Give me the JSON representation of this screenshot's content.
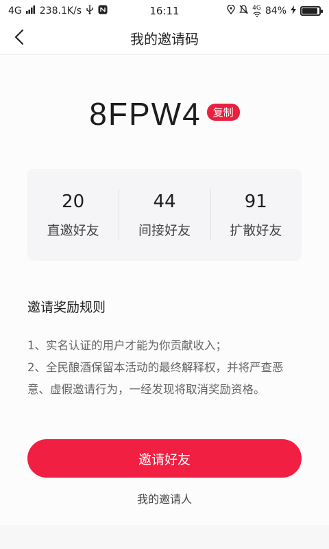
{
  "status_bar": {
    "network": "4G",
    "speed": "238.1K/s",
    "usb_icon": "usb-icon",
    "nfc_icon": "nfc-icon",
    "time": "16:11",
    "location_icon": "location-icon",
    "mute_icon": "mute-bell-icon",
    "signal_label": "4G",
    "battery_percent": "84%",
    "battery_level": 0.84,
    "charging_icon": "lightning-icon"
  },
  "nav": {
    "back_icon": "chevron-left-icon",
    "title": "我的邀请码"
  },
  "invite": {
    "code": "8FPW4",
    "copy_label": "复制"
  },
  "stats": [
    {
      "value": "20",
      "label": "直邀好友"
    },
    {
      "value": "44",
      "label": "间接好友"
    },
    {
      "value": "91",
      "label": "扩散好友"
    }
  ],
  "rules": {
    "title": "邀请奖励规则",
    "lines": [
      "1、实名认证的用户才能为你贡献收入；",
      "2、全民酿酒保留本活动的最终解释权，并将严查恶意、虚假邀请行为，一经发现将取消奖励资格。"
    ]
  },
  "actions": {
    "invite_button": "邀请好友",
    "my_inviter": "我的邀请人"
  },
  "colors": {
    "accent": "#f11f41",
    "copy_badge": "#e9213f",
    "card_bg": "#f5f4f6"
  }
}
